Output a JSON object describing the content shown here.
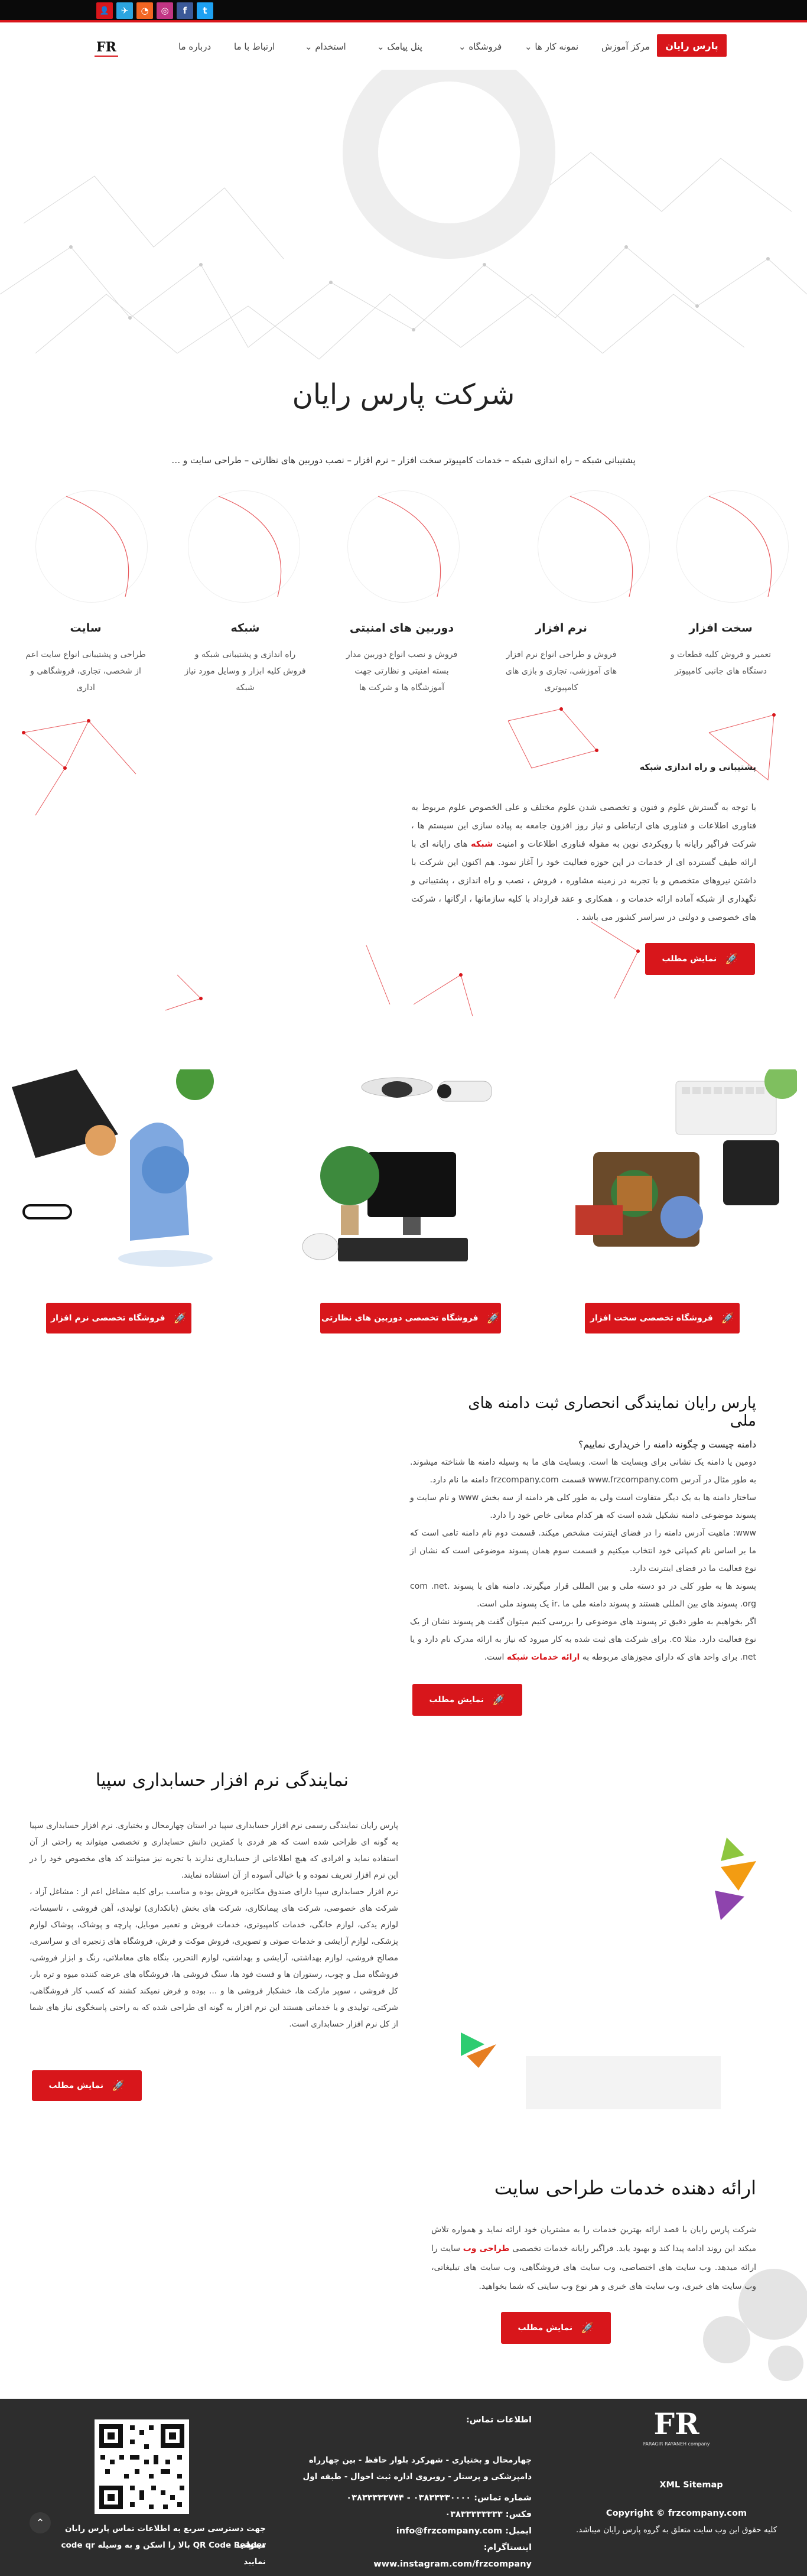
{
  "topbar": {
    "icons": [
      "twitter-icon",
      "facebook-icon",
      "instagram-icon",
      "rss-icon",
      "telegram-icon",
      "login-icon"
    ],
    "icon_glyphs": [
      "t",
      "f",
      "◎",
      "◔",
      "✈",
      "👤"
    ],
    "colors": [
      "#1da1f2",
      "#3b5998",
      "#c13584",
      "#f26522",
      "#2ca5e0",
      "#d8161b"
    ]
  },
  "nav": {
    "active": "پارس رایان",
    "items": [
      "مرکز آموزش",
      "نمونه کار ها",
      "فروشگاه",
      "پنل پیامک",
      "استخدام",
      "ارتباط با ما",
      "درباره ما"
    ],
    "logo": "FR"
  },
  "hero": {
    "title": "شرکت پارس رایان",
    "subtitle": "پشتیبانی شبکه – راه اندازی شبکه – خدمات کامپیوتر سخت افزار – نرم افزار – نصب دوربین های نظارتی – طراحی سایت و …"
  },
  "services": [
    {
      "title": "سخت افزار",
      "desc": "تعمیر و فروش کلیه قطعات و دستگاه های جانبی کامپیوتر"
    },
    {
      "title": "نرم افزار",
      "desc": "فروش و طراحی انواع نرم افزار های آموزشی، تجاری و بازی های کامپیوتری"
    },
    {
      "title": "دوربین های امنیتی",
      "desc": "فروش و نصب انواع دوربین مدار بسته امنیتی و نظارتی جهت آموزشگاه ها و شرکت ها"
    },
    {
      "title": "شبکه",
      "desc": "راه اندازی و پشتیبانی شبکه و فروش کلیه ابزار و وسایل مورد نیاز شبکه"
    },
    {
      "title": "سایت",
      "desc": "طراحی و پشتیبانی انواع سایت اعم از شخصی، تجاری، فروشگاهی و اداری"
    }
  ],
  "network": {
    "heading": "پشتیبانی و راه اندازی شبکه",
    "body_1": "با توجه به گسترش علوم و فنون و تخصصی شدن علوم مختلف و علی الخصوص علوم مربوط به فناوری اطلاعات و فناوری های ارتباطی و نیاز روز افزون جامعه به پیاده سازی این سیستم ها ، شرکت فراگیر رایانه با رویکردی نوین به مقوله فناوری اطلاعات و امنیت",
    "link": "شبکه",
    "body_2": "های رایانه ای با ارائه طیف گسترده ای از خدمات در این حوزه فعالیت خود را آغاز نمود. هم اکنون این شرکت با داشتن نیروهای متخصص و با تجربه در زمینه مشاوره ، فروش ، نصب و راه اندازی ، پشتیبانی و نگهداری از شبکه آماده ارائه خدمات و ، همکاری و عقد قرارداد با کلیه سازمانها ، ارگانها ، شرکت های خصوصی و دولتی در سراسر کشور می باشد .",
    "button": "نمایش مطلب"
  },
  "shops": [
    {
      "label": "فروشگاه تخصصی سخت افزار"
    },
    {
      "label": "فروشگاه تخصصی دوربین های نظارتی"
    },
    {
      "label": "فروشگاه تخصصی نرم افزار"
    }
  ],
  "domain": {
    "heading": "پارس رایان نمایندگی انحصاری ثبت دامنه های ملی",
    "question": "دامنه چیست و چگونه دامنه را خریداری نماییم؟",
    "p1": "دومین یا دامنه یک نشانی برای وبسایت ها است. وبسایت های ما به وسیله دامنه ها شناخته میشوند. به طور مثال در آدرس www.frzcompany.com قسمت frzcompany.com دامنه ما نام دارد.",
    "p2": "ساختار دامنه ها به یک دیگر متفاوت است ولی به طور کلی هر دامنه از سه بخش www و نام سایت و پسوند موضوعی دامنه تشکیل شده است که هر کدام معانی خاص خود را دارد.",
    "p3": "www: ماهیت آدرس دامنه را در فضای اینترنت مشخص میکند. قسمت دوم نام دامنه تامی است که ما بر اساس نام کمپانی خود انتخاب میکنیم و قسمت سوم همان پسوند موضوعی است که نشان از نوع فعالیت ما در فضای اینترنت دارد.",
    "p4": "پسوند ها به طور کلی در دو دسته ملی و بین المللی قرار میگیرند. دامنه های با پسوند .com .net .org پسوند های بین المللی هستند و پسوند دامنه ملی ما .ir یک پسوند ملی است.",
    "p5": "اگر بخواهیم به طور دقیق تر پسوند های موضوعی را بررسی کنیم میتوان گفت هر پسوند نشان از یک نوع فعالیت دارد. مثلا co. برای شرکت های ثبت شده به کار میرود که نیاز به ارائه مدرک نام دارد و یا net. برای واحد های که دارای مجوزهای مربوطه به",
    "p5_link": "ارائه خدمات شبکه",
    "p5_end": "است.",
    "button": "نمایش مطلب"
  },
  "sepidar": {
    "heading": "نمایندگی نرم افزار حسابداری سپیا",
    "p1": "پارس رایان نمایندگی رسمی نرم افزار حسابداری سپیا در استان چهارمحال و بختیاری. نرم افزار حسابداری سپیا به گونه ای طراحی شده است که هر فردی با کمترین دانش حسابداری و تخصصی میتواند به راحتی از آن استفاده نماید و افرادی که هیچ اطلاعاتی از حسابداری ندارند با تجربه نیز میتوانند کد های مخصوص خود را در این نرم افزار تعریف نموده و با خیالی آسوده از آن استفاده نمایند.",
    "p2": "نرم افزار حسابداری سپیا دارای صندوق مکانیزه فروش بوده و مناسب برای کلیه مشاغل اعم از : مشاغل آزاد ، شرکت های خصوصی، شرکت های پیمانکاری، شرکت های بخش (بانکداری) تولیدی، آهن فروشی ، تاسیسات، لوازم یدکی، لوازم خانگی، خدمات کامپیوتری، خدمات فروش و تعمیر موبایل، پارچه و پوشاک، پوشاک لوازم پزشکی، لوازم آرایشی و خدمات صوتی و تصویری، فروش موکت و فرش، فروشگاه های زنجیره ای و سراسری، مصالح فروشی، لوازم بهداشتی، آرایشی و بهداشتی، لوازم التحریر، بنگاه های معاملاتی، رنگ و ابزار فروشی، فروشگاه مبل و چوب، رستوران ها و فست فود ها، سنگ فروشی ها، فروشگاه های عرضه کننده میوه و تره بار، کل فروشی ، سوپر مارکت ها، خشکبار فروشی ها و … بوده و فرض نمیکند کشند که کسب کار فروشگاهی، شرکتی، تولیدی و یا خدماتی هستند این نرم افزار به گونه ای طراحی شده که به راحتی پاسخگوی نیاز های شما از کل نرم افزار حسابداری است.",
    "button": "نمایش مطلب"
  },
  "webdesign": {
    "heading": "ارائه دهنده خدمات طراحی سایت",
    "body_1": "شرکت پارس رایان با قصد ارائه بهترین خدمات را به مشتریان خود ارائه نماید و همواره تلاش میکند این روند ادامه پیدا کند و بهبود یابد. فراگیر رایانه خدمات تخصصی",
    "link": "طراحی وب",
    "body_2": "سایت را ارائه میدهد. وب سایت های اختصاصی، وب سایت های فروشگاهی، وب سایت های تبلیغاتی، وب سایت های خبری، وب سایت های خبری و هر نوع وب سایتی که شما بخواهید.",
    "button": "نمایش مطلب"
  },
  "footer": {
    "logo": "FR",
    "logo_caption": "FARAGIR RAYANEH company",
    "sitemap": "XML Sitemap",
    "copyright": "Copyright © frzcompany.com",
    "rights": "کلیه حقوق این وب سایت متعلق به گروه پارس رایان میباشد.",
    "contact_title": "اطلاعات تماس:",
    "address": "چهارمحال و بختیاری - شهرکرد بلوار حافظ - بین چهارراه دامپزشکی و پرستار - روبروی اداره ثبت احوال - طبقه اول",
    "phone": "شماره تماس: ۰۳۸۳۳۳۳۰۰۰۰ - ۰۳۸۳۳۳۳۳۷۴۴",
    "fax": "فکس: ۰۳۸۳۳۳۳۳۳۳۳",
    "email": "ایمیل: info@frzcompany.com",
    "instagram": "اینستاگرام: www.instagram.com/frzcompany",
    "qr_text_1": "جهت دسترسی سریع به اطلاعات تماس پارس رایان میتوانید",
    "qr_text_2": "QR Code Reader بالا را اسکن و به وسیله code qr نمایید",
    "scrolltop": "⌃"
  }
}
